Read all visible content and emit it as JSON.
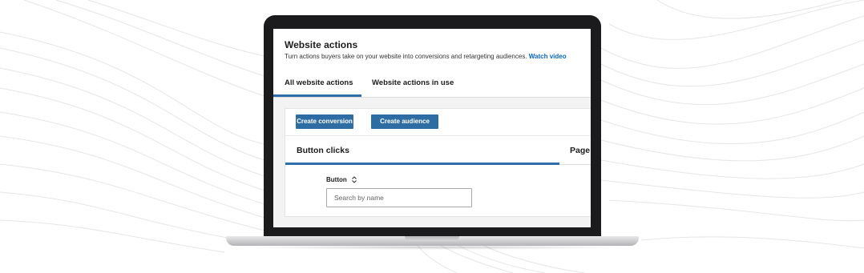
{
  "page": {
    "title": "Website actions",
    "subtitle": "Turn actions buyers take on your website into conversions and retargeting audiences.",
    "watch_video_link": "Watch video"
  },
  "tabs": [
    {
      "label": "All website actions",
      "active": true
    },
    {
      "label": "Website actions in use",
      "active": false
    }
  ],
  "toolbar": {
    "create_conversion_label": "Create conversion",
    "create_audience_label": "Create audience"
  },
  "subtabs": [
    {
      "label": "Button clicks",
      "active": true
    },
    {
      "label": "Page",
      "active": false
    }
  ],
  "table": {
    "column_header": "Button",
    "search_placeholder": "Search by name"
  },
  "colors": {
    "accent": "#2e6da4",
    "link": "#0a66c2",
    "laptop_bezel": "#1b1b1d"
  }
}
